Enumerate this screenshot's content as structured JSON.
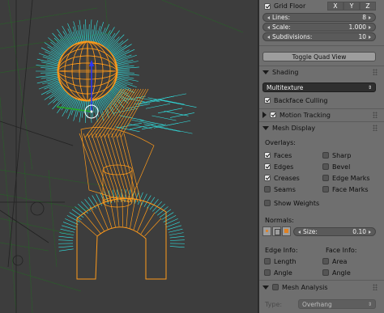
{
  "grid_floor": {
    "label": "Grid Floor",
    "axes": [
      "X",
      "Y",
      "Z"
    ],
    "lines_label": "Lines:",
    "lines_value": "8",
    "scale_label": "Scale:",
    "scale_value": "1.000",
    "subdivisions_label": "Subdivisions:",
    "subdivisions_value": "10"
  },
  "toggle_quad_view": "Toggle Quad View",
  "shading": {
    "title": "Shading",
    "mode": "Multitexture",
    "backface_culling": "Backface Culling"
  },
  "motion_tracking": {
    "title": "Motion Tracking"
  },
  "mesh_display": {
    "title": "Mesh Display",
    "overlays_label": "Overlays:",
    "overlays": {
      "faces": "Faces",
      "sharp": "Sharp",
      "edges": "Edges",
      "bevel": "Bevel",
      "creases": "Creases",
      "edge_marks": "Edge Marks",
      "seams": "Seams",
      "face_marks": "Face Marks",
      "show_weights": "Show Weights"
    },
    "normals_label": "Normals:",
    "size_label": "Size:",
    "size_value": "0.10",
    "edge_info_label": "Edge Info:",
    "face_info_label": "Face Info:",
    "edge_info": {
      "length": "Length",
      "angle": "Angle"
    },
    "face_info": {
      "area": "Area",
      "angle": "Angle"
    }
  },
  "mesh_analysis": {
    "title": "Mesh Analysis",
    "type_label": "Type:",
    "type_value": "Overhang"
  },
  "colors": {
    "normals_cyan": "#2fe6e6",
    "wire_orange": "#ff9a1a",
    "panel_bg": "#6f6f6f",
    "viewport_bg": "#3d3d3d"
  }
}
